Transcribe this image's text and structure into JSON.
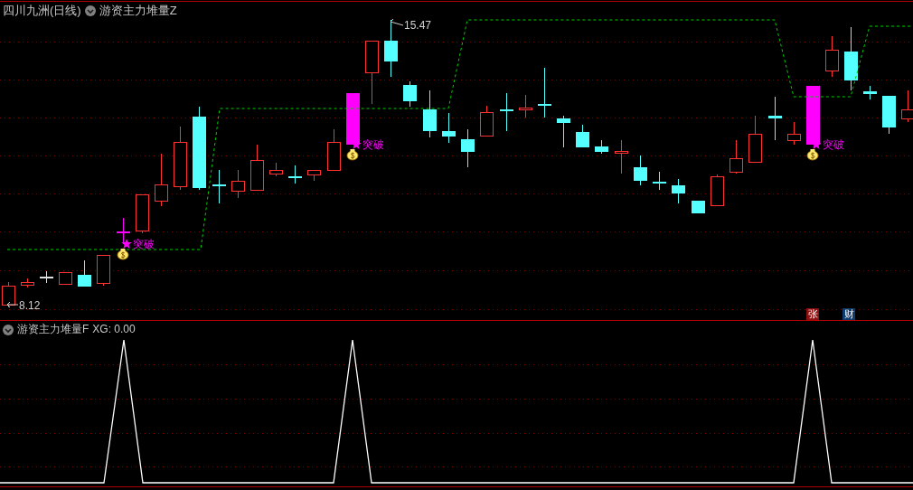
{
  "header": {
    "stock_title": "四川九洲(日线)",
    "indicator": "游资主力堆量Z"
  },
  "price_labels": {
    "high": "15.47",
    "low": "8.12"
  },
  "signals": [
    {
      "label": "突破"
    },
    {
      "label": "突破"
    },
    {
      "label": "突破"
    }
  ],
  "badges": [
    {
      "label": "张",
      "color": "#8b1010"
    },
    {
      "label": "财",
      "color": "#0f3c6e"
    }
  ],
  "lower_pane": {
    "indicator": "游资主力堆量F",
    "reading": "XG: 0.00"
  }
}
